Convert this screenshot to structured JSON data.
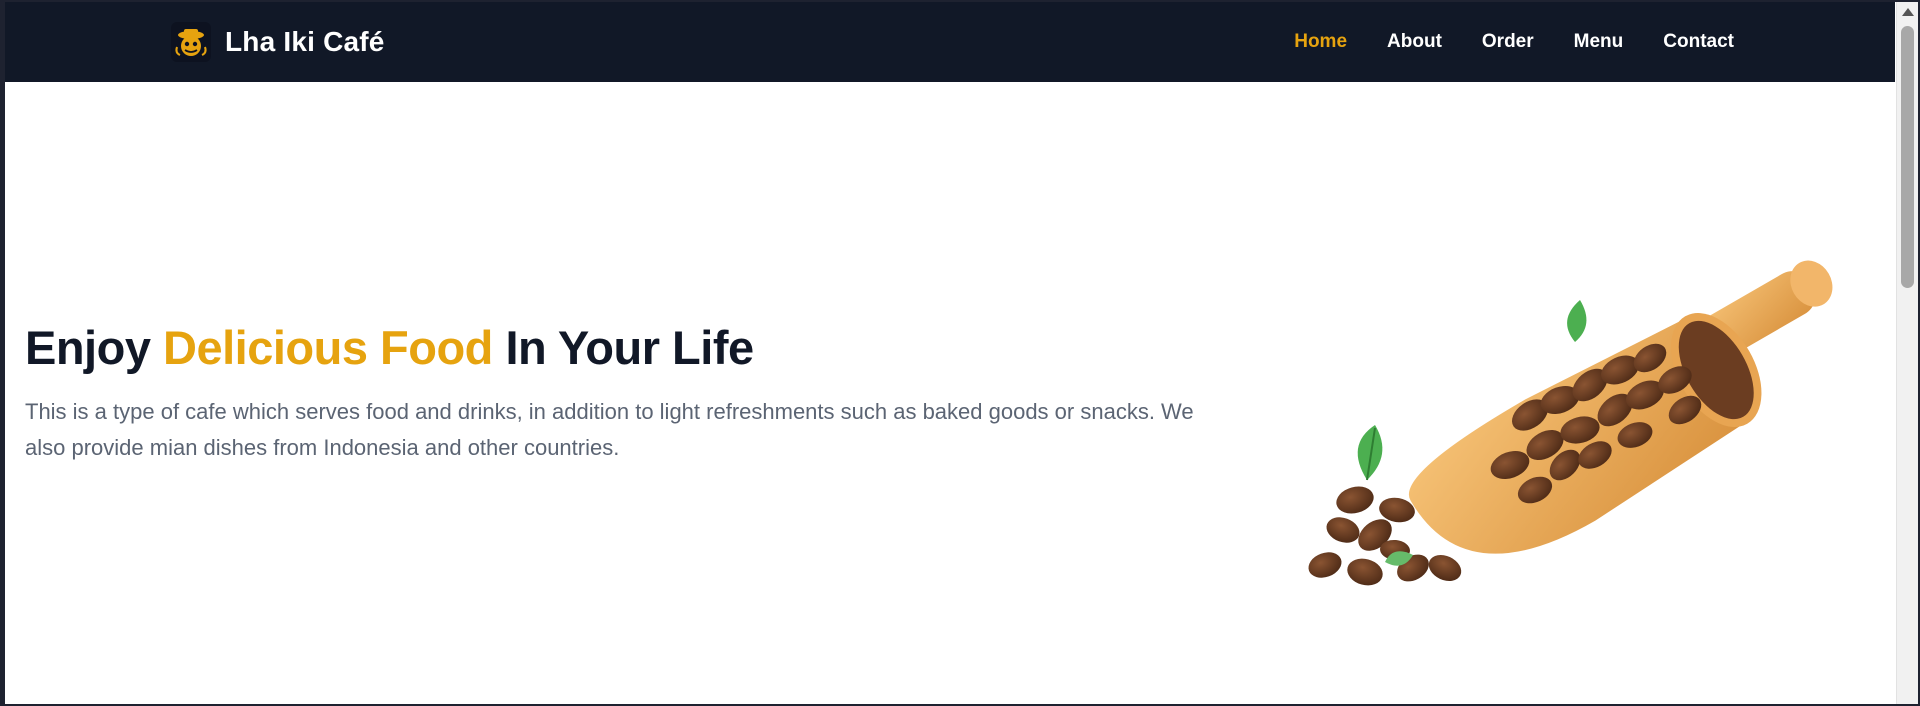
{
  "navbar": {
    "brand_name": "Lha Iki Café",
    "logo_icon": "cafe-logo-icon",
    "links": [
      {
        "label": "Home",
        "active": true
      },
      {
        "label": "About",
        "active": false
      },
      {
        "label": "Order",
        "active": false
      },
      {
        "label": "Menu",
        "active": false
      },
      {
        "label": "Contact",
        "active": false
      }
    ]
  },
  "hero": {
    "title_part1": "Enjoy",
    "title_accent": "Delicious Food",
    "title_part2": "In Your Life",
    "description": "This is a type of cafe which serves food and drinks, in addition to light refreshments such as baked goods or snacks. We also provide mian dishes from Indonesia and other countries.",
    "image_icon": "coffee-beans-scoop-image"
  },
  "colors": {
    "navbar_bg": "#111827",
    "accent": "#e6a30f",
    "title": "#111827",
    "text_muted": "#5b6473"
  }
}
